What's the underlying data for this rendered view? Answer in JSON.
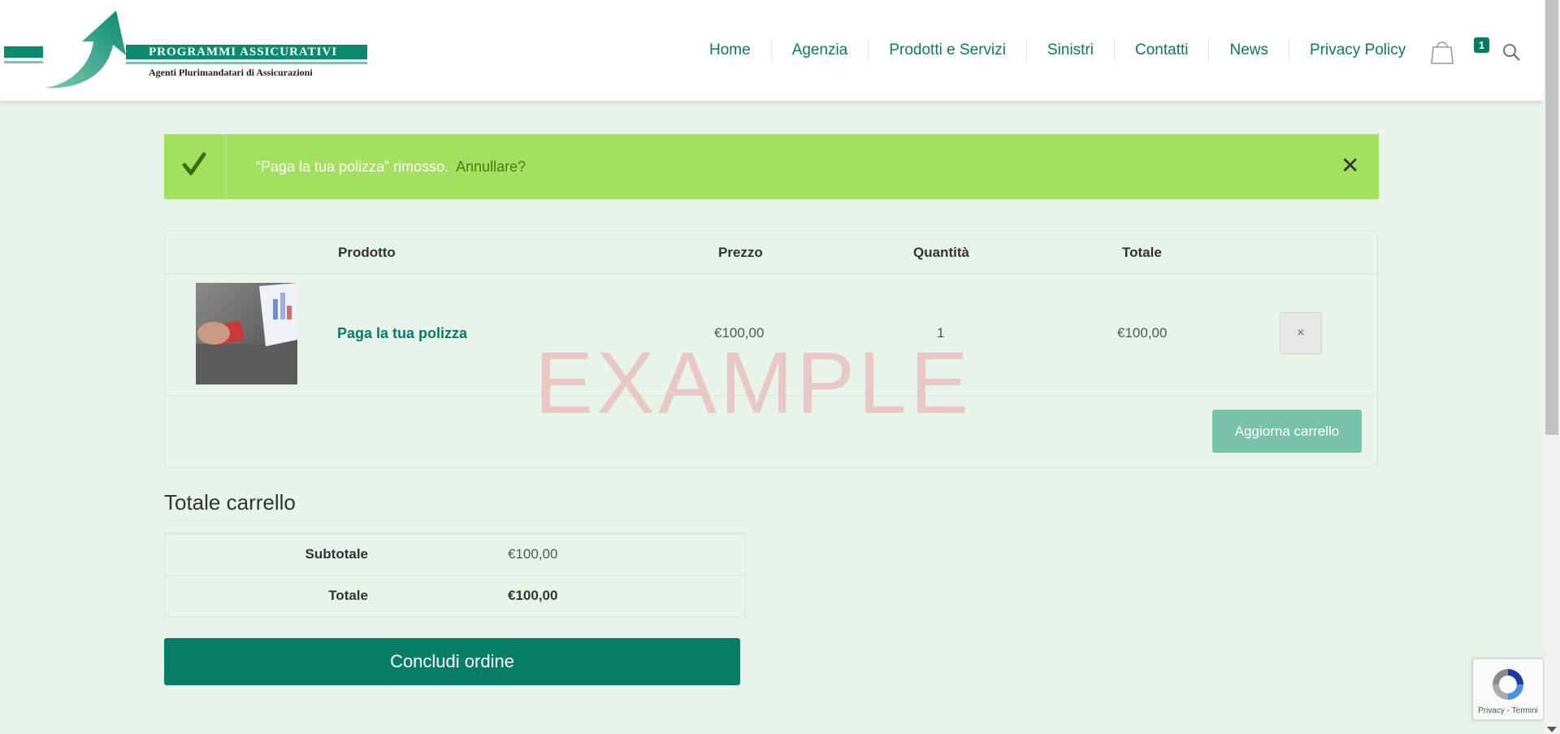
{
  "logo": {
    "banner_text": "PROGRAMMI  ASSICURATIVI",
    "subtitle": "Agenti Plurimandatari di Assicurazioni"
  },
  "nav": {
    "items": [
      "Home",
      "Agenzia",
      "Prodotti e Servizi",
      "Sinistri",
      "Contatti",
      "News",
      "Privacy Policy"
    ],
    "cart_count": "1",
    "cart_icon": "cart-icon",
    "search_icon": "search-icon"
  },
  "notice": {
    "message": "“Paga la tua polizza” rimosso.",
    "undo_label": "Annullare?",
    "close_label": "✕",
    "icon": "checkmark-icon"
  },
  "cart_table": {
    "headers": {
      "product": "Prodotto",
      "price": "Prezzo",
      "quantity": "Quantità",
      "total": "Totale"
    },
    "rows": [
      {
        "product_name": "Paga la tua polizza",
        "price": "€100,00",
        "quantity": "1",
        "total": "€100,00",
        "remove_label": "×"
      }
    ],
    "update_button": "Aggiorna carrello"
  },
  "watermark": "EXAMPLE",
  "totals": {
    "title": "Totale carrello",
    "subtotal_label": "Subtotale",
    "subtotal_value": "€100,00",
    "total_label": "Totale",
    "total_value": "€100,00"
  },
  "checkout_button": "Concludi ordine",
  "recaptcha": {
    "links": "Privacy - Termini"
  },
  "colors": {
    "accent": "#077d65",
    "notice_bg": "#a3e060",
    "page_bg": "#e8f3ea"
  }
}
